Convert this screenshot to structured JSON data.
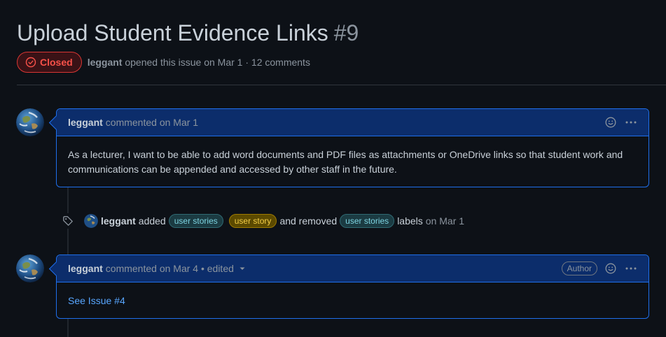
{
  "issue": {
    "title": "Upload Student Evidence Links",
    "number": "#9",
    "state": "Closed",
    "author": "leggant",
    "opened_text": "opened this issue on Mar 1 · 12 comments"
  },
  "comments": [
    {
      "author": "leggant",
      "meta": "commented on Mar 1",
      "body": "As a lecturer, I want to be able to add word documents and PDF files as attachments or OneDrive links so that student work and communications can be appended and accessed by other staff in the future."
    },
    {
      "author": "leggant",
      "meta": "commented on Mar 4 • edited",
      "badge": "Author",
      "body_link": "See Issue #4"
    }
  ],
  "label_event": {
    "author": "leggant",
    "added_text": "added",
    "labels_added": [
      "user stories",
      "user story"
    ],
    "removed_text": "and removed",
    "labels_removed": [
      "user stories"
    ],
    "suffix": "labels",
    "date": "on Mar 1"
  },
  "colors": {
    "closed_red": "#f85149",
    "link_blue": "#58a6ff",
    "label_teal": "#7dd3e0",
    "label_gold": "#f3cd47"
  }
}
